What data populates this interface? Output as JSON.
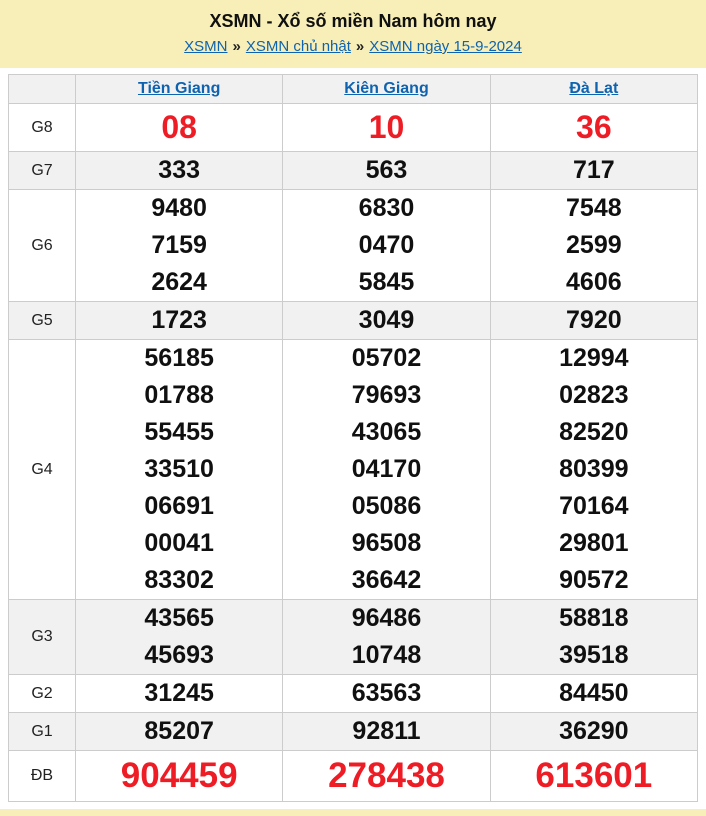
{
  "colors": {
    "page_band_bg": "#f8efb8",
    "link_blue": "#0e63b0",
    "accent_red": "#ee1c25",
    "row_alt_bg": "#f1f1f1",
    "border": "#cccccc"
  },
  "header": {
    "title": "XSMN - Xổ số miền Nam hôm nay",
    "separator": "»",
    "breadcrumb": [
      {
        "label": "XSMN"
      },
      {
        "label": "XSMN chủ nhật"
      },
      {
        "label": "XSMN ngày 15-9-2024"
      }
    ]
  },
  "table": {
    "provinces": [
      "Tiền Giang",
      "Kiên Giang",
      "Đà Lạt"
    ],
    "rows": [
      {
        "label": "G8",
        "emphasis": "g8",
        "cells": [
          [
            "08"
          ],
          [
            "10"
          ],
          [
            "36"
          ]
        ]
      },
      {
        "label": "G7",
        "emphasis": "",
        "cells": [
          [
            "333"
          ],
          [
            "563"
          ],
          [
            "717"
          ]
        ]
      },
      {
        "label": "G6",
        "emphasis": "",
        "cells": [
          [
            "9480",
            "7159",
            "2624"
          ],
          [
            "6830",
            "0470",
            "5845"
          ],
          [
            "7548",
            "2599",
            "4606"
          ]
        ]
      },
      {
        "label": "G5",
        "emphasis": "",
        "cells": [
          [
            "1723"
          ],
          [
            "3049"
          ],
          [
            "7920"
          ]
        ]
      },
      {
        "label": "G4",
        "emphasis": "",
        "cells": [
          [
            "56185",
            "01788",
            "55455",
            "33510",
            "06691",
            "00041",
            "83302"
          ],
          [
            "05702",
            "79693",
            "43065",
            "04170",
            "05086",
            "96508",
            "36642"
          ],
          [
            "12994",
            "02823",
            "82520",
            "80399",
            "70164",
            "29801",
            "90572"
          ]
        ]
      },
      {
        "label": "G3",
        "emphasis": "",
        "cells": [
          [
            "43565",
            "45693"
          ],
          [
            "96486",
            "10748"
          ],
          [
            "58818",
            "39518"
          ]
        ]
      },
      {
        "label": "G2",
        "emphasis": "",
        "cells": [
          [
            "31245"
          ],
          [
            "63563"
          ],
          [
            "84450"
          ]
        ]
      },
      {
        "label": "G1",
        "emphasis": "",
        "cells": [
          [
            "85207"
          ],
          [
            "92811"
          ],
          [
            "36290"
          ]
        ]
      },
      {
        "label": "ĐB",
        "emphasis": "db",
        "cells": [
          [
            "904459"
          ],
          [
            "278438"
          ],
          [
            "613601"
          ]
        ]
      }
    ]
  }
}
